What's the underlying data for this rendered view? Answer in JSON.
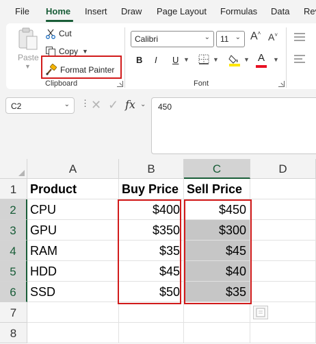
{
  "ribbon": {
    "tabs": [
      "File",
      "Home",
      "Insert",
      "Draw",
      "Page Layout",
      "Formulas",
      "Data",
      "Rev"
    ],
    "active_tab": "Home",
    "clipboard": {
      "paste_label": "Paste",
      "cut_label": "Cut",
      "copy_label": "Copy",
      "format_painter_label": "Format Painter",
      "group_label": "Clipboard"
    },
    "font": {
      "font_name": "Calibri",
      "font_size": "11",
      "grow_label": "A",
      "shrink_label": "A",
      "bold": "B",
      "italic": "I",
      "underline": "U",
      "font_color_letter": "A",
      "group_label": "Font"
    }
  },
  "formula_bar": {
    "name_box": "C2",
    "fx_label": "fx",
    "value": "450"
  },
  "sheet": {
    "columns": [
      "A",
      "B",
      "C",
      "D"
    ],
    "selected_column": "C",
    "rows": [
      "1",
      "2",
      "3",
      "4",
      "5",
      "6",
      "7",
      "8"
    ],
    "selected_rows": [
      "2",
      "3",
      "4",
      "5",
      "6"
    ],
    "headers": {
      "product": "Product",
      "buy_price": "Buy Price",
      "sell_price": "Sell Price"
    },
    "data": [
      {
        "product": "CPU",
        "buy": "$400",
        "sell": "$450"
      },
      {
        "product": "GPU",
        "buy": "$350",
        "sell": "$300"
      },
      {
        "product": "RAM",
        "buy": "$35",
        "sell": "$45"
      },
      {
        "product": "HDD",
        "buy": "$45",
        "sell": "$40"
      },
      {
        "product": "SSD",
        "buy": "$50",
        "sell": "$35"
      }
    ]
  },
  "colors": {
    "accent_green": "#185c37",
    "highlight_red": "#d11a1a",
    "selection_fill": "#c6c6c6",
    "highlight_yellow": "#ffe600",
    "font_color_red": "#e81123"
  }
}
